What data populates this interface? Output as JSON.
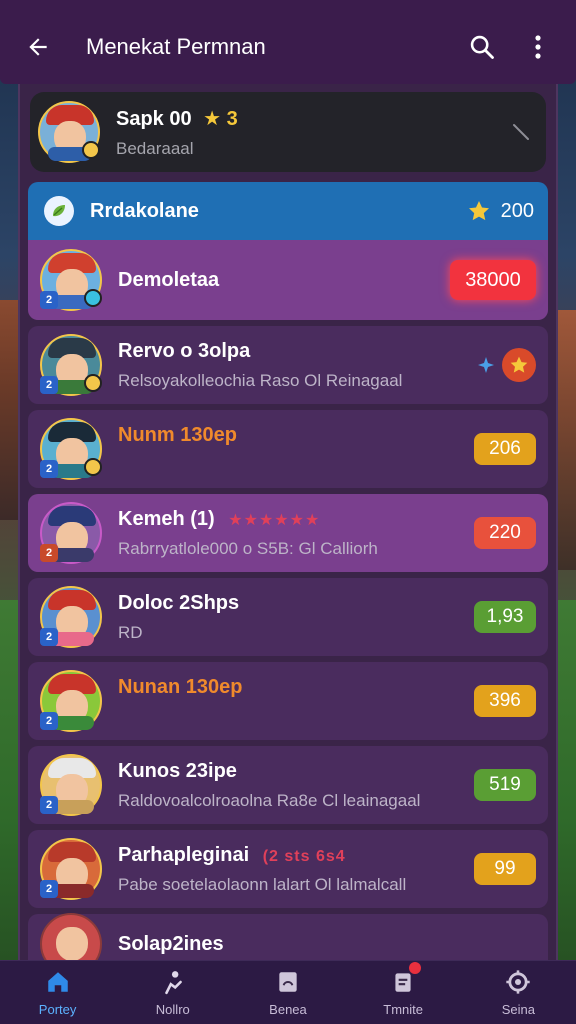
{
  "header": {
    "title": "Menekat Permnan"
  },
  "my_card": {
    "name": "Sapk 00",
    "stars": "★ 3",
    "subtitle": "Bedaraaal"
  },
  "section": {
    "title": "Rrdakolane",
    "score": "200"
  },
  "rows": [
    {
      "name": "Demoletaa",
      "subtitle": "",
      "stars": "",
      "value": "38000",
      "pill_color": "#f2333e",
      "highlight": true
    },
    {
      "name": "Rervo o 3olpa",
      "subtitle": "Relsoyakolleochia Raso Ol Reinagaal",
      "stars": "",
      "value": "",
      "pill_color": "",
      "highlight": false
    },
    {
      "name": "Nunm 130ep",
      "subtitle": "",
      "stars": "",
      "value": "206",
      "pill_color": "#e3a21c",
      "highlight": false,
      "name_color": "#f08a2c"
    },
    {
      "name": "Kemeh (1)",
      "subtitle": "Rabrryatlole000 o S5B: Gl Calliorh",
      "stars": "★★★★★★",
      "value": "220",
      "pill_color": "#e8513c",
      "highlight": true
    },
    {
      "name": "Doloc 2Shps",
      "subtitle": "RD",
      "stars": "",
      "value": "1,93",
      "pill_color": "#5a9e34",
      "highlight": false
    },
    {
      "name": "Nunan 130ep",
      "subtitle": "",
      "stars": "",
      "value": "396",
      "pill_color": "#e3a21c",
      "highlight": false,
      "name_color": "#f08a2c"
    },
    {
      "name": "Kunos 23ipe",
      "subtitle": "Raldovoalcolroaolna Ra8e Cl leainagaal",
      "stars": "",
      "value": "519",
      "pill_color": "#5a9e34",
      "highlight": false
    },
    {
      "name": "Parhapleginai",
      "subtitle": "Pabe soetelaolaonn lalart Ol lalmalcall",
      "stars": "(2 sts 6s4",
      "value": "99",
      "pill_color": "#e3a21c",
      "highlight": false
    },
    {
      "name": "Solap2ines",
      "subtitle": "",
      "stars": "",
      "value": "",
      "pill_color": "",
      "highlight": false
    }
  ],
  "tabs": [
    {
      "label": "Portey",
      "active": true
    },
    {
      "label": "Nollro",
      "active": false
    },
    {
      "label": "Benea",
      "active": false
    },
    {
      "label": "Tmnite",
      "active": false
    },
    {
      "label": "Seina",
      "active": false
    }
  ],
  "colors": {
    "appbar": "#3b1c4c",
    "panel": "#3a2448",
    "section_header": "#1f6fb4",
    "row": "#4a2c5e",
    "row_highlight": "#7a3f8e",
    "tab_active": "#5cb2ff"
  },
  "icons": [
    "back-arrow-icon",
    "search-icon",
    "more-vert-icon",
    "star-icon",
    "home-icon",
    "player-icon",
    "card-icon",
    "clipboard-icon",
    "settings-icon"
  ]
}
